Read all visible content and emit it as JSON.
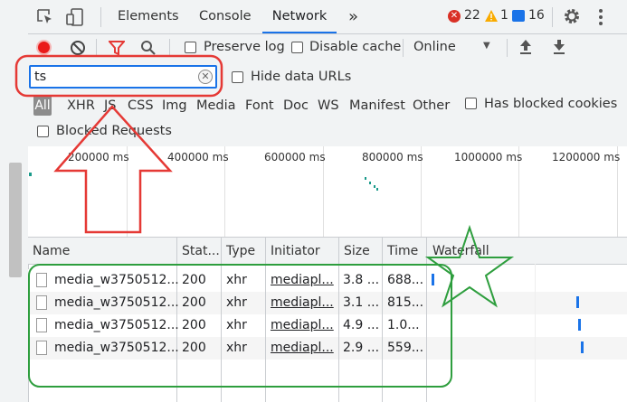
{
  "tabs": {
    "elements": "Elements",
    "console": "Console",
    "network": "Network",
    "more": "»"
  },
  "status": {
    "errors": "22",
    "warnings": "1",
    "messages": "16"
  },
  "toolbar": {
    "preserve_log": "Preserve log",
    "disable_cache": "Disable cache",
    "throttle": "Online"
  },
  "filter": {
    "value": "ts",
    "hide_data_urls": "Hide data URLs"
  },
  "types": [
    "All",
    "XHR",
    "JS",
    "CSS",
    "Img",
    "Media",
    "Font",
    "Doc",
    "WS",
    "Manifest",
    "Other"
  ],
  "has_blocked_cookies": "Has blocked cookies",
  "blocked_requests": "Blocked Requests",
  "overview_ticks": [
    "200000 ms",
    "400000 ms",
    "600000 ms",
    "800000 ms",
    "1000000 ms",
    "1200000 ms"
  ],
  "columns": [
    "Name",
    "Stat...",
    "Type",
    "Initiator",
    "Size",
    "Time",
    "Waterfall"
  ],
  "rows": [
    {
      "name": "media_w3750512...",
      "status": "200",
      "type": "xhr",
      "initiator": "mediapl...",
      "size": "3.8 ...",
      "time": "688..."
    },
    {
      "name": "media_w3750512...",
      "status": "200",
      "type": "xhr",
      "initiator": "mediapl...",
      "size": "3.1 ...",
      "time": "815..."
    },
    {
      "name": "media_w3750512...",
      "status": "200",
      "type": "xhr",
      "initiator": "mediapl...",
      "size": "4.9 ...",
      "time": "1.0..."
    },
    {
      "name": "media_w3750512...",
      "status": "200",
      "type": "xhr",
      "initiator": "mediapl...",
      "size": "2.9 ...",
      "time": "559..."
    }
  ],
  "colors": {
    "accent": "#1a73e8",
    "annotation_red": "#e53935",
    "annotation_green": "#2e9e3e",
    "record_red": "#ea1a1a"
  }
}
